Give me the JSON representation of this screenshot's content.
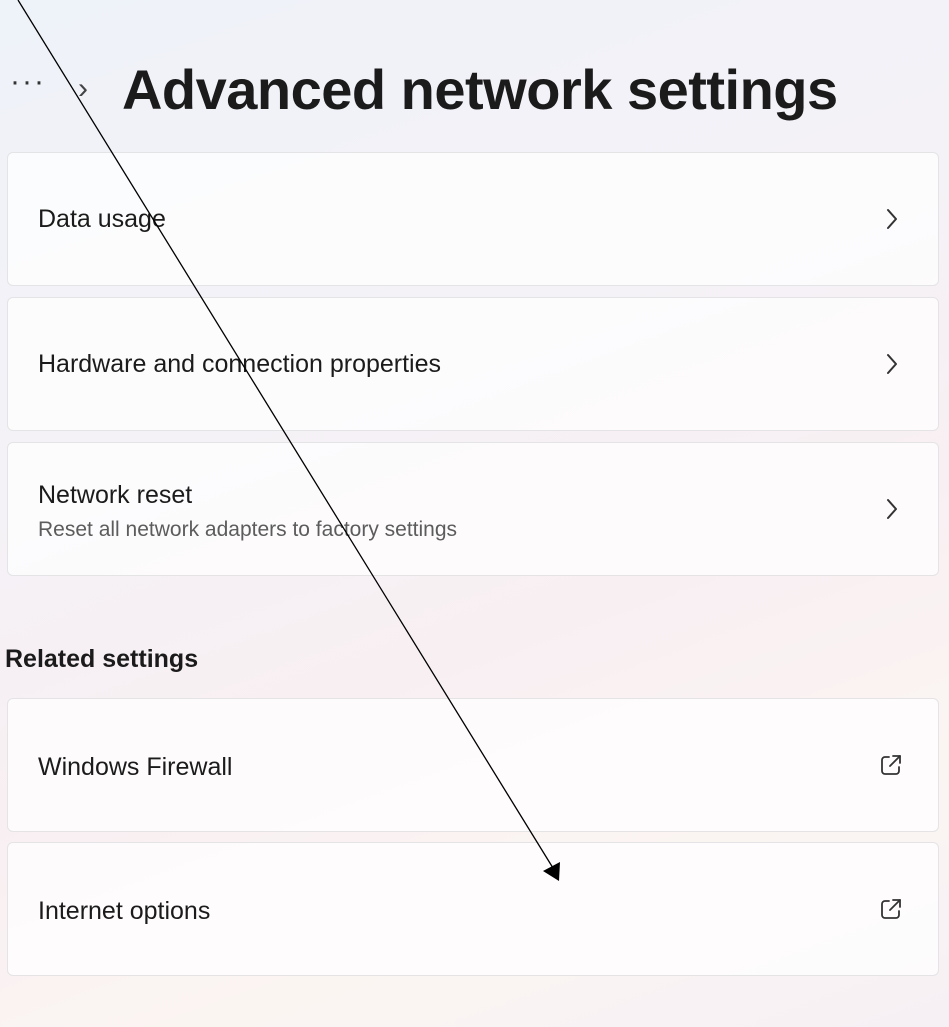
{
  "header": {
    "overflow_label": "···",
    "separator": "›",
    "title": "Advanced network settings"
  },
  "settings": [
    {
      "title": "Data usage",
      "subtitle": "",
      "icon": "chevron-right-icon"
    },
    {
      "title": "Hardware and connection properties",
      "subtitle": "",
      "icon": "chevron-right-icon"
    },
    {
      "title": "Network reset",
      "subtitle": "Reset all network adapters to factory settings",
      "icon": "chevron-right-icon"
    }
  ],
  "related": {
    "heading": "Related settings",
    "items": [
      {
        "title": "Windows Firewall",
        "icon": "external-link-icon"
      },
      {
        "title": "Internet options",
        "icon": "external-link-icon"
      }
    ]
  },
  "colors": {
    "text": "#1b1b1b",
    "subtext": "#5c5c5c",
    "card_border": "#e4e4e6",
    "annotation": "#000000"
  }
}
